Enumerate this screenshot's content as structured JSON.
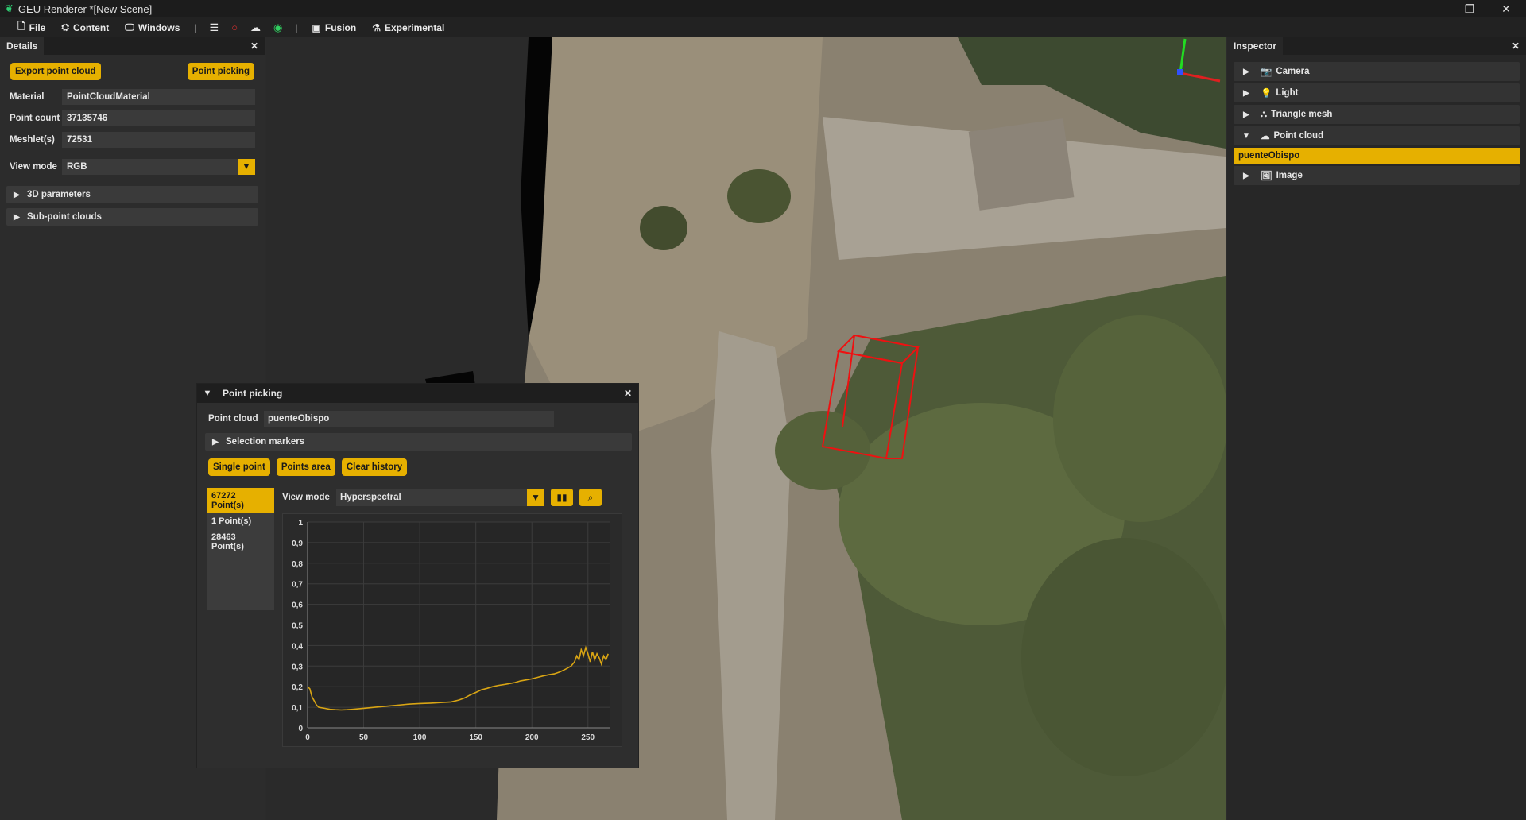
{
  "window": {
    "title": "GEU Renderer *[New Scene]"
  },
  "menubar": {
    "file": "File",
    "content": "Content",
    "windows": "Windows",
    "fusion": "Fusion",
    "experimental": "Experimental"
  },
  "details": {
    "tab": "Details",
    "export_button": "Export point cloud",
    "picking_button": "Point picking",
    "material_label": "Material",
    "material_value": "PointCloudMaterial",
    "point_count_label": "Point count",
    "point_count_value": "37135746",
    "meshlets_label": "Meshlet(s)",
    "meshlets_value": "72531",
    "view_mode_label": "View mode",
    "view_mode_value": "RGB",
    "sections": [
      "3D parameters",
      "Sub-point clouds"
    ]
  },
  "inspector": {
    "tab": "Inspector",
    "items": [
      {
        "label": "Camera",
        "icon": "camera-icon",
        "expanded": false
      },
      {
        "label": "Light",
        "icon": "light-bulb-icon",
        "expanded": false
      },
      {
        "label": "Triangle mesh",
        "icon": "mesh-icon",
        "expanded": false
      },
      {
        "label": "Point cloud",
        "icon": "cloud-icon",
        "expanded": true
      }
    ],
    "selected_child": "puenteObispo",
    "image_item": {
      "label": "Image",
      "icon": "image-icon"
    }
  },
  "point_picking": {
    "title": "Point picking",
    "point_cloud_label": "Point cloud",
    "point_cloud_value": "puenteObispo",
    "selection_markers": "Selection markers",
    "single_point": "Single point",
    "points_area": "Points area",
    "clear_history": "Clear history",
    "history": [
      "67272 Point(s)",
      "1 Point(s)",
      "28463 Point(s)"
    ],
    "view_mode_label": "View mode",
    "view_mode_value": "Hyperspectral"
  },
  "colors": {
    "accent": "#e6b000",
    "line": "#d9a514",
    "axis_x": "#e02020",
    "axis_y": "#22dd22",
    "axis_z": "#3050ff"
  },
  "chart_data": {
    "type": "line",
    "xlim": [
      0,
      270
    ],
    "ylim": [
      0,
      1
    ],
    "xticks": [
      "0",
      "50",
      "100",
      "150",
      "200",
      "250"
    ],
    "yticks": [
      "0",
      "0,1",
      "0,2",
      "0,3",
      "0,4",
      "0,5",
      "0,6",
      "0,7",
      "0,8",
      "0,9",
      "1"
    ],
    "grid": true,
    "series": [
      {
        "x": [
          0,
          2,
          4,
          6,
          8,
          10,
          15,
          20,
          25,
          30,
          35,
          40,
          50,
          60,
          70,
          80,
          90,
          100,
          110,
          120,
          128,
          135,
          140,
          145,
          150,
          155,
          160,
          165,
          170,
          175,
          180,
          185,
          190,
          195,
          200,
          205,
          210,
          215,
          220,
          225,
          230,
          235,
          238,
          240,
          242,
          244,
          246,
          248,
          250,
          252,
          254,
          256,
          258,
          260,
          262,
          264,
          266,
          268
        ],
        "y": [
          0.2,
          0.19,
          0.15,
          0.13,
          0.11,
          0.1,
          0.095,
          0.09,
          0.088,
          0.087,
          0.088,
          0.09,
          0.095,
          0.1,
          0.105,
          0.11,
          0.115,
          0.118,
          0.12,
          0.123,
          0.126,
          0.135,
          0.145,
          0.16,
          0.172,
          0.185,
          0.192,
          0.2,
          0.206,
          0.21,
          0.215,
          0.22,
          0.228,
          0.233,
          0.238,
          0.245,
          0.252,
          0.258,
          0.262,
          0.272,
          0.285,
          0.3,
          0.32,
          0.35,
          0.33,
          0.38,
          0.35,
          0.39,
          0.36,
          0.32,
          0.37,
          0.33,
          0.36,
          0.34,
          0.31,
          0.35,
          0.33,
          0.36
        ]
      }
    ]
  }
}
